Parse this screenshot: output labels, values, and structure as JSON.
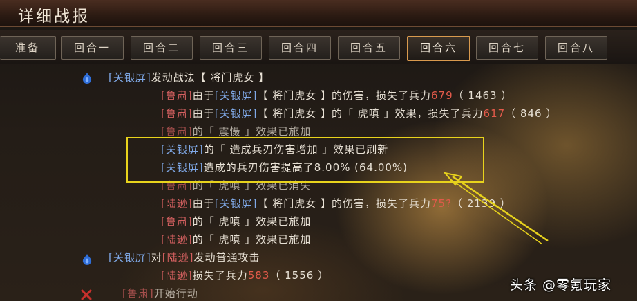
{
  "window": {
    "title": "详细战报"
  },
  "tabs": [
    "准备",
    "回合一",
    "回合二",
    "回合三",
    "回合四",
    "回合五",
    "回合六",
    "回合七",
    "回合八"
  ],
  "active_tab_index": 6,
  "log": [
    {
      "segs": [
        {
          "t": "[关银屏]",
          "c": "b"
        },
        {
          "t": "发动战法【 将门虎女 】"
        }
      ]
    },
    {
      "segs": [
        {
          "t": "[鲁肃]",
          "c": "r"
        },
        {
          "t": "由于"
        },
        {
          "t": "[关银屏]",
          "c": "b"
        },
        {
          "t": "【 将门虎女 】的伤害，损失了兵力"
        },
        {
          "t": "679",
          "c": "num"
        },
        {
          "t": "（ 1463 ）"
        }
      ]
    },
    {
      "segs": [
        {
          "t": "[鲁肃]",
          "c": "r"
        },
        {
          "t": "由于"
        },
        {
          "t": "[关银屏]",
          "c": "b"
        },
        {
          "t": "【 将门虎女 】的「 虎嗔 」效果，损失了兵力"
        },
        {
          "t": "617",
          "c": "num"
        },
        {
          "t": "（ 846 ）"
        }
      ]
    },
    {
      "segs": [
        {
          "t": "[鲁肃]",
          "c": "r"
        },
        {
          "t": "的「 震慑 」效果已施加"
        }
      ]
    },
    {
      "segs": [
        {
          "t": "[关银屏]",
          "c": "b"
        },
        {
          "t": "的「 造成兵刃伤害增加 」效果已刷新"
        }
      ]
    },
    {
      "segs": [
        {
          "t": "[关银屏]",
          "c": "b"
        },
        {
          "t": "造成的兵刃伤害提高了8.00% (64.00%)"
        }
      ]
    },
    {
      "segs": [
        {
          "t": "[鲁肃]",
          "c": "r"
        },
        {
          "t": "的「 虎嗔 」效果已消失"
        }
      ]
    },
    {
      "segs": [
        {
          "t": "[陆逊]",
          "c": "r"
        },
        {
          "t": "由于"
        },
        {
          "t": "[关银屏]",
          "c": "b"
        },
        {
          "t": "【 将门虎女 】的伤害，损失了兵力"
        },
        {
          "t": "75?",
          "c": "num"
        },
        {
          "t": "（ 2139 ）"
        }
      ]
    },
    {
      "segs": [
        {
          "t": "[鲁肃]",
          "c": "r"
        },
        {
          "t": "的「 虎嗔 」效果已施加"
        }
      ]
    },
    {
      "segs": [
        {
          "t": "[陆逊]",
          "c": "r"
        },
        {
          "t": "的「 虎嗔 」效果已施加"
        }
      ]
    },
    {
      "segs": [
        {
          "t": "[关银屏]",
          "c": "b"
        },
        {
          "t": "对"
        },
        {
          "t": "[陆逊]",
          "c": "r"
        },
        {
          "t": "发动普通攻击"
        }
      ]
    },
    {
      "segs": [
        {
          "t": "[陆逊]",
          "c": "r"
        },
        {
          "t": "损失了兵力"
        },
        {
          "t": "583",
          "c": "num"
        },
        {
          "t": "（ 1556 ）"
        }
      ]
    },
    {
      "segs": [
        {
          "t": "[鲁肃]",
          "c": "r"
        },
        {
          "t": "开始行动"
        }
      ]
    }
  ],
  "watermark": "头条 @零氪玩家",
  "colors": {
    "ally": "#7fa8e6",
    "enemy": "#d46060",
    "damage": "#e25a4a",
    "highlight": "#e8d31c",
    "tab_active_border": "#d99a4e"
  },
  "icons": [
    "blue-flame-icon",
    "red-cross-icon",
    "arrow-annotation-icon"
  ]
}
